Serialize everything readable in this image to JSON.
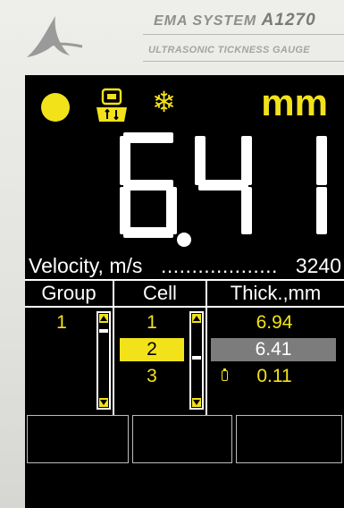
{
  "header": {
    "brand_line1": "EMA  SYSTEM",
    "model": "A1270",
    "brand_line2": "ULTRASONIC TICKNESS GAUGE",
    "logo_icon": "ema-logo-icon"
  },
  "indicators": {
    "sensor_status_icon": "status-dot-icon",
    "probe_icon": "probe-contact-icon",
    "temperature_icon": "snowflake-icon",
    "snowflake_glyph": "❄",
    "units": "mm"
  },
  "measurement": {
    "value": "6.41"
  },
  "velocity": {
    "label": "Velocity, m/s",
    "dots": "..................................................",
    "value": "3240"
  },
  "table": {
    "headers": {
      "group": "Group",
      "cell": "Cell",
      "thick": "Thick.,mm"
    },
    "group_values": [
      "1"
    ],
    "cell_values": [
      "1",
      "2",
      "3"
    ],
    "thick_values": [
      "6.94",
      "6.41",
      "0.11"
    ],
    "selected_cell_index": 1
  },
  "soft_keys": [
    "",
    "",
    ""
  ],
  "colors": {
    "accent_yellow": "#f2e21a",
    "screen_bg": "#000000",
    "text_white": "#ffffff",
    "selection_gray": "#7c7c7c"
  }
}
